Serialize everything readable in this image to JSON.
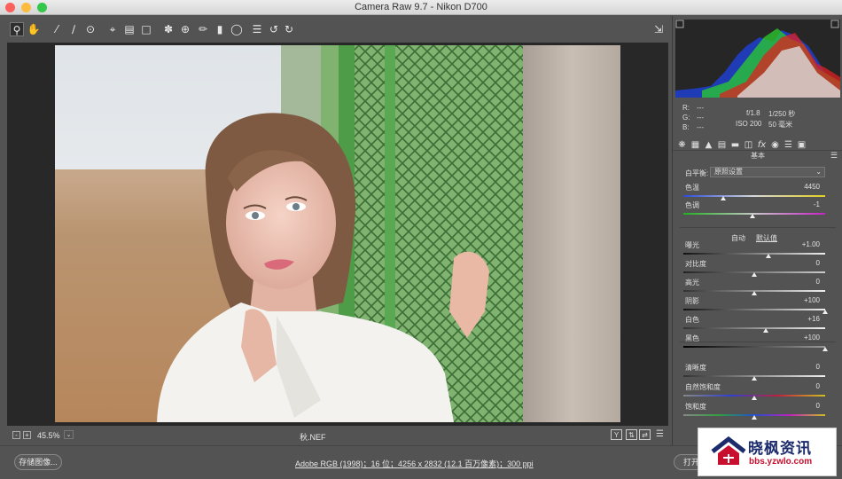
{
  "window": {
    "title": "Camera Raw 9.7 -  Nikon D700"
  },
  "toolbar": {
    "tools": [
      "zoom-icon",
      "hand-icon",
      "white-balance-icon",
      "color-sampler-icon",
      "target-adjust-icon",
      "crop-icon",
      "straighten-icon",
      "transform-icon",
      "spot-removal-icon",
      "red-eye-icon",
      "adjustment-brush-icon",
      "graduated-filter-icon",
      "radial-filter-icon",
      "preferences-icon",
      "rotate-left-icon",
      "rotate-right-icon"
    ],
    "fullscreen_icon": "export-icon"
  },
  "histogram": {
    "r_label": "R:",
    "g_label": "G:",
    "b_label": "B:",
    "r_val": "---",
    "g_val": "---",
    "b_val": "---",
    "aperture": "f/1.8",
    "shutter": "1/250 秒",
    "iso": "ISO 200",
    "focal": "50 毫米"
  },
  "panel": {
    "section_title": "基本",
    "wb_label": "白平衡:",
    "wb_value": "原照设置",
    "auto": "自动",
    "default": "默认值",
    "sliders": [
      {
        "label": "色温",
        "value": "4450",
        "pos": 0.28
      },
      {
        "label": "色调",
        "value": "-1",
        "pos": 0.49
      },
      {
        "label": "曝光",
        "value": "+1.00",
        "pos": 0.6
      },
      {
        "label": "对比度",
        "value": "0",
        "pos": 0.5
      },
      {
        "label": "高光",
        "value": "0",
        "pos": 0.5
      },
      {
        "label": "阴影",
        "value": "+100",
        "pos": 1.0
      },
      {
        "label": "白色",
        "value": "+16",
        "pos": 0.58
      },
      {
        "label": "黑色",
        "value": "+100",
        "pos": 1.0
      },
      {
        "label": "清晰度",
        "value": "0",
        "pos": 0.5
      },
      {
        "label": "自然饱和度",
        "value": "0",
        "pos": 0.5
      },
      {
        "label": "饱和度",
        "value": "0",
        "pos": 0.5
      }
    ]
  },
  "bottom": {
    "zoom": "45.5%",
    "filename": "秋.NEF",
    "y_label": "Y"
  },
  "footer": {
    "save_label": "存储图像...",
    "workflow": "Adobe RGB (1998)；16 位；4256 x 2832 (12.1 百万像素)；300 ppi",
    "open_label": "打开"
  },
  "watermark": {
    "brand": "晓枫资讯",
    "url": "bbs.yzwlo.com"
  },
  "colors": {
    "accent_red": "#c8102e",
    "window_bg": "#535353"
  }
}
